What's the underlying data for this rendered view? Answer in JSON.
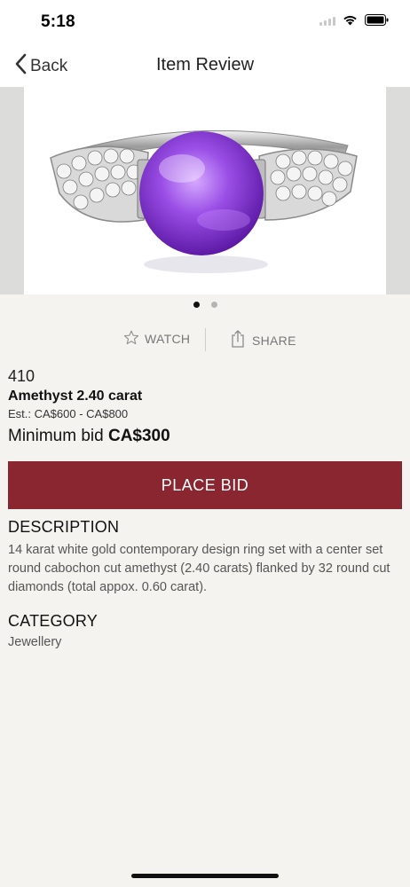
{
  "status_bar": {
    "time": "5:18"
  },
  "nav": {
    "back_label": "Back",
    "title": "Item Review"
  },
  "carousel": {
    "image_count": 2,
    "active_index": 0
  },
  "actions": {
    "watch_label": "WATCH",
    "share_label": "SHARE"
  },
  "item": {
    "lot_number": "410",
    "title": "Amethyst 2.40 carat",
    "estimate": "Est.: CA$600 - CA$800",
    "min_bid_label": "Minimum bid",
    "min_bid_value": "CA$300"
  },
  "place_bid_label": "PLACE BID",
  "description": {
    "heading": "DESCRIPTION",
    "text": "14 karat white gold contemporary design ring set with a center set round cabochon cut amethyst (2.40 carats) flanked by 32 round cut diamonds (total appox. 0.60 carat)."
  },
  "category": {
    "heading": "CATEGORY",
    "value": "Jewellery"
  },
  "colors": {
    "accent": "#892630",
    "background": "#f5f3ef"
  }
}
